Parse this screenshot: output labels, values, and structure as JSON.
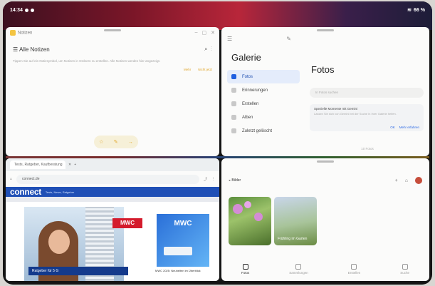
{
  "status_bar": {
    "time": "14:34",
    "battery": "66 %"
  },
  "notes": {
    "title": "Notizen",
    "list_title": "Alle Notizen",
    "hint_text": "Tippen Sie auf ein Notizsymbol, um Notizen in Ordnern zu erstellen. Alle Notizen werden hier angezeigt.",
    "link1": "Mehr",
    "link2": "Nicht jetzt",
    "toolbar": [
      "☆",
      "✎",
      "→"
    ],
    "fab": "+"
  },
  "gallery": {
    "title": "Galerie",
    "main_title": "Fotos",
    "nav": [
      {
        "label": "Fotos",
        "active": true
      },
      {
        "label": "Erinnerungen",
        "active": false
      },
      {
        "label": "Erstellen",
        "active": false
      },
      {
        "label": "Alben",
        "active": false
      },
      {
        "label": "Zuletzt gelöscht",
        "active": false
      }
    ],
    "search_placeholder": "In Fotos suchen",
    "card_title": "Spezielle Momente mit Gemini",
    "card_body": "Lassen Sie sich von Gemini bei der Suche in Ihrer Galerie helfen.",
    "card_ok": "OK",
    "card_more": "Mehr erfahren",
    "count": "10 Fotos"
  },
  "browser": {
    "tab_label": "Tests, Ratgeber, Kaufberatung",
    "url": "connect.de",
    "brand": "connect",
    "tagline": "Tests, News, Ratgeber",
    "mwc1": "MWC",
    "mwc2": "MWC",
    "news": "MWC 2025: Neuheiten im Überblick",
    "ad": "Ratgeber für 5 G"
  },
  "photos": {
    "title": "Bilder",
    "photo1_label": "",
    "photo2_label": "Frühling im Garten",
    "tabs": [
      "Fotos",
      "Sammlungen",
      "Erstellen",
      "Suche"
    ]
  }
}
